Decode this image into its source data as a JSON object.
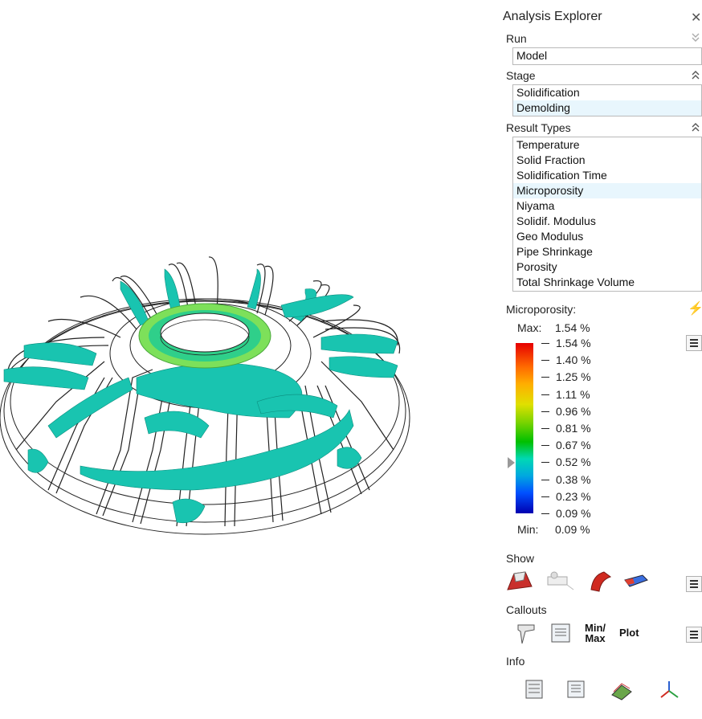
{
  "panel": {
    "title": "Analysis Explorer",
    "run": {
      "label": "Run",
      "value": "Model"
    },
    "stage": {
      "label": "Stage",
      "items": [
        "Solidification",
        "Demolding"
      ],
      "selected": "Demolding"
    },
    "result_types": {
      "label": "Result Types",
      "items": [
        "Temperature",
        "Solid Fraction",
        "Solidification Time",
        "Microporosity",
        "Niyama",
        "Solidif. Modulus",
        "Geo Modulus",
        "Pipe Shrinkage",
        "Porosity",
        "Total Shrinkage Volume"
      ],
      "selected": "Microporosity"
    },
    "legend": {
      "title": "Microporosity:",
      "max_label": "Max:",
      "max_value": "1.54 %",
      "min_label": "Min:",
      "min_value": "0.09 %",
      "ticks": [
        "1.54 %",
        "1.40 %",
        "1.25 %",
        "1.11 %",
        "0.96 %",
        "0.81 %",
        "0.67 %",
        "0.52 %",
        "0.38 %",
        "0.23 %",
        "0.09 %"
      ]
    },
    "show": {
      "label": "Show"
    },
    "callouts": {
      "label": "Callouts",
      "minmax_top": "Min/",
      "minmax_bottom": "Max",
      "plot": "Plot"
    },
    "info": {
      "label": "Info"
    }
  },
  "colors": {
    "selection": "#e8f6fd",
    "isosurface": "#19c4b0",
    "hot_ring": "#7de05a"
  }
}
